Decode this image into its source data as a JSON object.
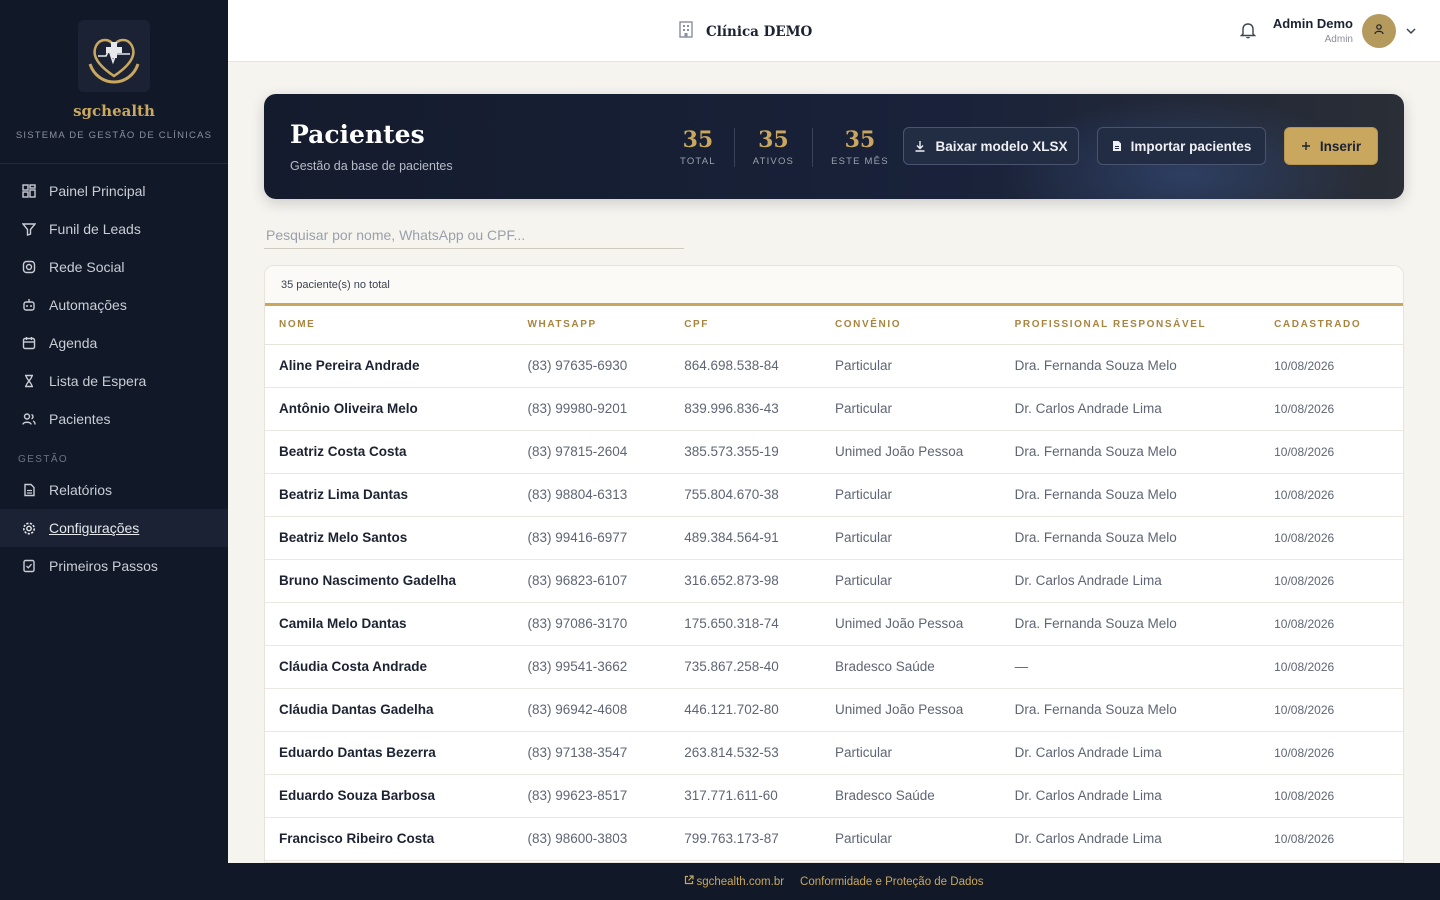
{
  "brand": {
    "name": "sgchealth",
    "subtitle": "SISTEMA DE GESTÃO DE CLÍNICAS"
  },
  "sidebar": {
    "items": [
      {
        "label": "Painel Principal",
        "icon": "dashboard-icon"
      },
      {
        "label": "Funil de Leads",
        "icon": "funnel-icon"
      },
      {
        "label": "Rede Social",
        "icon": "instagram-icon"
      },
      {
        "label": "Automações",
        "icon": "robot-icon"
      },
      {
        "label": "Agenda",
        "icon": "calendar-icon"
      },
      {
        "label": "Lista de Espera",
        "icon": "hourglass-icon"
      },
      {
        "label": "Pacientes",
        "icon": "users-icon"
      }
    ],
    "section_label": "GESTÃO",
    "items2": [
      {
        "label": "Relatórios",
        "icon": "report-icon"
      },
      {
        "label": "Configurações",
        "icon": "gear-icon",
        "active": true
      },
      {
        "label": "Primeiros Passos",
        "icon": "checklist-icon"
      }
    ]
  },
  "header": {
    "clinic": "Clínica DEMO",
    "user_name": "Admin Demo",
    "user_role": "Admin"
  },
  "hero": {
    "title": "Pacientes",
    "subtitle": "Gestão da base de pacientes",
    "stats": [
      {
        "value": "35",
        "label": "TOTAL"
      },
      {
        "value": "35",
        "label": "ATIVOS"
      },
      {
        "value": "35",
        "label": "ESTE MÊS"
      }
    ],
    "btn_xlsx": "Baixar modelo XLSX",
    "btn_import": "Importar pacientes",
    "btn_insert": "Inserir"
  },
  "search": {
    "placeholder": "Pesquisar por nome, WhatsApp ou CPF..."
  },
  "table": {
    "count_label": "35 paciente(s) no total",
    "columns": [
      "NOME",
      "WHATSAPP",
      "CPF",
      "CONVÊNIO",
      "PROFISSIONAL RESPONSÁVEL",
      "CADASTRADO"
    ],
    "rows": [
      [
        "Aline Pereira Andrade",
        "(83) 97635-6930",
        "864.698.538-84",
        "Particular",
        "Dra. Fernanda Souza Melo",
        "10/08/2026"
      ],
      [
        "Antônio Oliveira Melo",
        "(83) 99980-9201",
        "839.996.836-43",
        "Particular",
        "Dr. Carlos Andrade Lima",
        "10/08/2026"
      ],
      [
        "Beatriz Costa Costa",
        "(83) 97815-2604",
        "385.573.355-19",
        "Unimed João Pessoa",
        "Dra. Fernanda Souza Melo",
        "10/08/2026"
      ],
      [
        "Beatriz Lima Dantas",
        "(83) 98804-6313",
        "755.804.670-38",
        "Particular",
        "Dra. Fernanda Souza Melo",
        "10/08/2026"
      ],
      [
        "Beatriz Melo Santos",
        "(83) 99416-6977",
        "489.384.564-91",
        "Particular",
        "Dra. Fernanda Souza Melo",
        "10/08/2026"
      ],
      [
        "Bruno Nascimento Gadelha",
        "(83) 96823-6107",
        "316.652.873-98",
        "Particular",
        "Dr. Carlos Andrade Lima",
        "10/08/2026"
      ],
      [
        "Camila Melo Dantas",
        "(83) 97086-3170",
        "175.650.318-74",
        "Unimed João Pessoa",
        "Dra. Fernanda Souza Melo",
        "10/08/2026"
      ],
      [
        "Cláudia Costa Andrade",
        "(83) 99541-3662",
        "735.867.258-40",
        "Bradesco Saúde",
        "—",
        "10/08/2026"
      ],
      [
        "Cláudia Dantas Gadelha",
        "(83) 96942-4608",
        "446.121.702-80",
        "Unimed João Pessoa",
        "Dra. Fernanda Souza Melo",
        "10/08/2026"
      ],
      [
        "Eduardo Dantas Bezerra",
        "(83) 97138-3547",
        "263.814.532-53",
        "Particular",
        "Dr. Carlos Andrade Lima",
        "10/08/2026"
      ],
      [
        "Eduardo Souza Barbosa",
        "(83) 99623-8517",
        "317.771.611-60",
        "Bradesco Saúde",
        "Dr. Carlos Andrade Lima",
        "10/08/2026"
      ],
      [
        "Francisco Ribeiro Costa",
        "(83) 98600-3803",
        "799.763.173-87",
        "Particular",
        "Dr. Carlos Andrade Lima",
        "10/08/2026"
      ]
    ]
  },
  "footer": {
    "site": "sgchealth.com.br",
    "compliance": "Conformidade e Proteção de Dados"
  },
  "colors": {
    "sidebar": "#111827",
    "gold": "#c9a75f",
    "background": "#f6f4ef"
  }
}
